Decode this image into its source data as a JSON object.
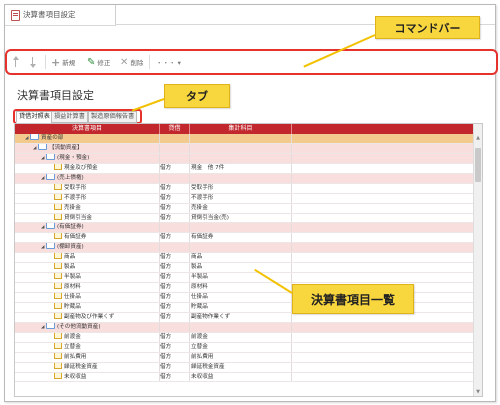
{
  "window": {
    "tab_title": "決算書項目設定"
  },
  "toolbar": {
    "new_label": "新規",
    "edit_label": "修正",
    "delete_label": "削除",
    "more_label": "・・・ ▾"
  },
  "callouts": {
    "command_bar": "コマンドバー",
    "tab": "タブ",
    "item_list": "決算書項目一覧"
  },
  "page": {
    "title": "決算書項目設定"
  },
  "tabs": [
    {
      "label": "貸借対照表"
    },
    {
      "label": "損益計算書"
    },
    {
      "label": "製造原価報告書"
    }
  ],
  "grid": {
    "columns": [
      "決算書項目",
      "貸借",
      "集計科目"
    ],
    "rows": [
      {
        "kind": "root",
        "indent": 0,
        "tri": "◢",
        "icon": "folder",
        "label": "資産の部",
        "side": "",
        "account": ""
      },
      {
        "kind": "grp",
        "indent": 1,
        "tri": "◢",
        "icon": "folder",
        "label": "【流動資産】",
        "side": "",
        "account": ""
      },
      {
        "kind": "grp",
        "indent": 2,
        "tri": "◢",
        "icon": "folder",
        "label": "(現金・預金)",
        "side": "",
        "account": ""
      },
      {
        "kind": "leaf",
        "indent": 3,
        "tri": "",
        "icon": "leaf",
        "label": "現金及び預金",
        "side": "借方",
        "account": "現金　他 7件"
      },
      {
        "kind": "grp",
        "indent": 2,
        "tri": "◢",
        "icon": "folder",
        "label": "(売上債権)",
        "side": "",
        "account": ""
      },
      {
        "kind": "leaf",
        "indent": 3,
        "tri": "",
        "icon": "leaf",
        "label": "受取手形",
        "side": "借方",
        "account": "受取手形"
      },
      {
        "kind": "leaf",
        "indent": 3,
        "tri": "",
        "icon": "leaf",
        "label": "不渡手形",
        "side": "借方",
        "account": "不渡手形"
      },
      {
        "kind": "leaf",
        "indent": 3,
        "tri": "",
        "icon": "leaf",
        "label": "売掛金",
        "side": "借方",
        "account": "売掛金"
      },
      {
        "kind": "leaf",
        "indent": 3,
        "tri": "",
        "icon": "leaf",
        "label": "貸倒引当金",
        "side": "借方",
        "account": "貸倒引当金(売)"
      },
      {
        "kind": "grp",
        "indent": 2,
        "tri": "◢",
        "icon": "folder",
        "label": "(有価証券)",
        "side": "",
        "account": ""
      },
      {
        "kind": "leaf",
        "indent": 3,
        "tri": "",
        "icon": "leaf",
        "label": "有価証券",
        "side": "借方",
        "account": "有価証券"
      },
      {
        "kind": "grp",
        "indent": 2,
        "tri": "◢",
        "icon": "folder",
        "label": "(棚卸資産)",
        "side": "",
        "account": ""
      },
      {
        "kind": "leaf",
        "indent": 3,
        "tri": "",
        "icon": "leaf",
        "label": "商品",
        "side": "借方",
        "account": "商品"
      },
      {
        "kind": "leaf",
        "indent": 3,
        "tri": "",
        "icon": "leaf",
        "label": "製品",
        "side": "借方",
        "account": "製品"
      },
      {
        "kind": "leaf",
        "indent": 3,
        "tri": "",
        "icon": "leaf",
        "label": "半製品",
        "side": "借方",
        "account": "半製品"
      },
      {
        "kind": "leaf",
        "indent": 3,
        "tri": "",
        "icon": "leaf",
        "label": "原材料",
        "side": "借方",
        "account": "原材料"
      },
      {
        "kind": "leaf",
        "indent": 3,
        "tri": "",
        "icon": "leaf",
        "label": "仕掛品",
        "side": "借方",
        "account": "仕掛品"
      },
      {
        "kind": "leaf",
        "indent": 3,
        "tri": "",
        "icon": "leaf",
        "label": "貯蔵品",
        "side": "借方",
        "account": "貯蔵品"
      },
      {
        "kind": "leaf",
        "indent": 3,
        "tri": "",
        "icon": "leaf",
        "label": "副産物及び作業くず",
        "side": "借方",
        "account": "副産物作業くず"
      },
      {
        "kind": "grp",
        "indent": 2,
        "tri": "◢",
        "icon": "folder",
        "label": "(その他流動資産)",
        "side": "",
        "account": ""
      },
      {
        "kind": "leaf",
        "indent": 3,
        "tri": "",
        "icon": "leaf",
        "label": "前渡金",
        "side": "借方",
        "account": "前渡金"
      },
      {
        "kind": "leaf",
        "indent": 3,
        "tri": "",
        "icon": "leaf",
        "label": "立替金",
        "side": "借方",
        "account": "立替金"
      },
      {
        "kind": "leaf",
        "indent": 3,
        "tri": "",
        "icon": "leaf",
        "label": "前払費用",
        "side": "借方",
        "account": "前払費用"
      },
      {
        "kind": "leaf",
        "indent": 3,
        "tri": "",
        "icon": "leaf",
        "label": "繰延税金資産",
        "side": "借方",
        "account": "繰延税金資産"
      },
      {
        "kind": "leaf",
        "indent": 3,
        "tri": "",
        "icon": "leaf",
        "label": "未収収益",
        "side": "借方",
        "account": "未収収益"
      }
    ]
  },
  "colors": {
    "accent": "#c1272d",
    "callout": "#f8d63e",
    "highlight_border": "#e5322d",
    "group_row": "#f9dede",
    "root_row": "#f4c98e"
  }
}
